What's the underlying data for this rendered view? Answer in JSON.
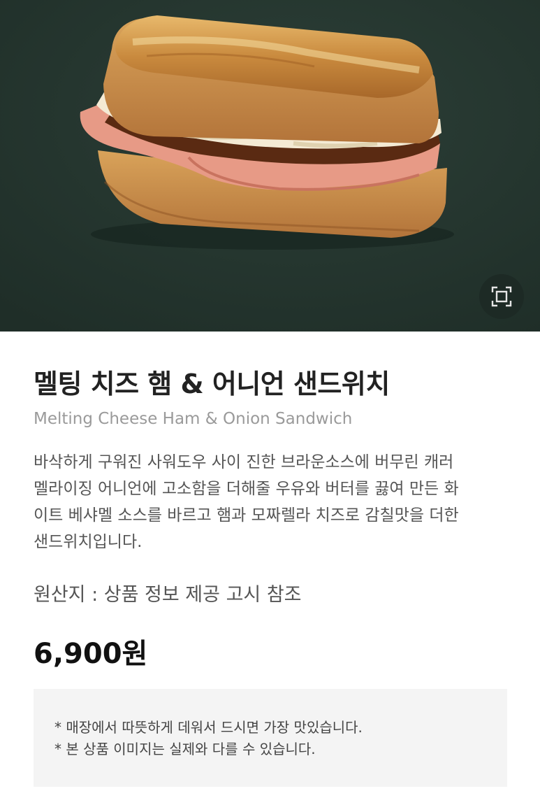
{
  "product": {
    "title": "멜팅 치즈 햄 & 어니언 샌드위치",
    "subtitle": "Melting Cheese Ham & Onion Sandwich",
    "description_lines": [
      "바삭하게 구워진 사워도우 사이 진한 브라운소스에 버무린 캐러",
      "멜라이징 어니언에 고소함을 더해줄 우유와 버터를 끓여 만든 화",
      "이트 베샤멜 소스를 바르고 햄과 모짜렐라 치즈로 감칠맛을 더한",
      "샌드위치입니다."
    ],
    "origin": "원산지 : 상품 정보 제공 고시 참조",
    "price": "6,900원"
  },
  "notice": {
    "lines": [
      "* 매장에서 따뜻하게 데워서 드시면 가장 맛있습니다.",
      "* 본 상품 이미지는 실제와 다를 수 있습니다."
    ]
  },
  "hero": {
    "image": "melting-cheese-ham-onion-sandwich",
    "background_color": "#25362f",
    "zoom_icon": "expand-frame-icon"
  }
}
